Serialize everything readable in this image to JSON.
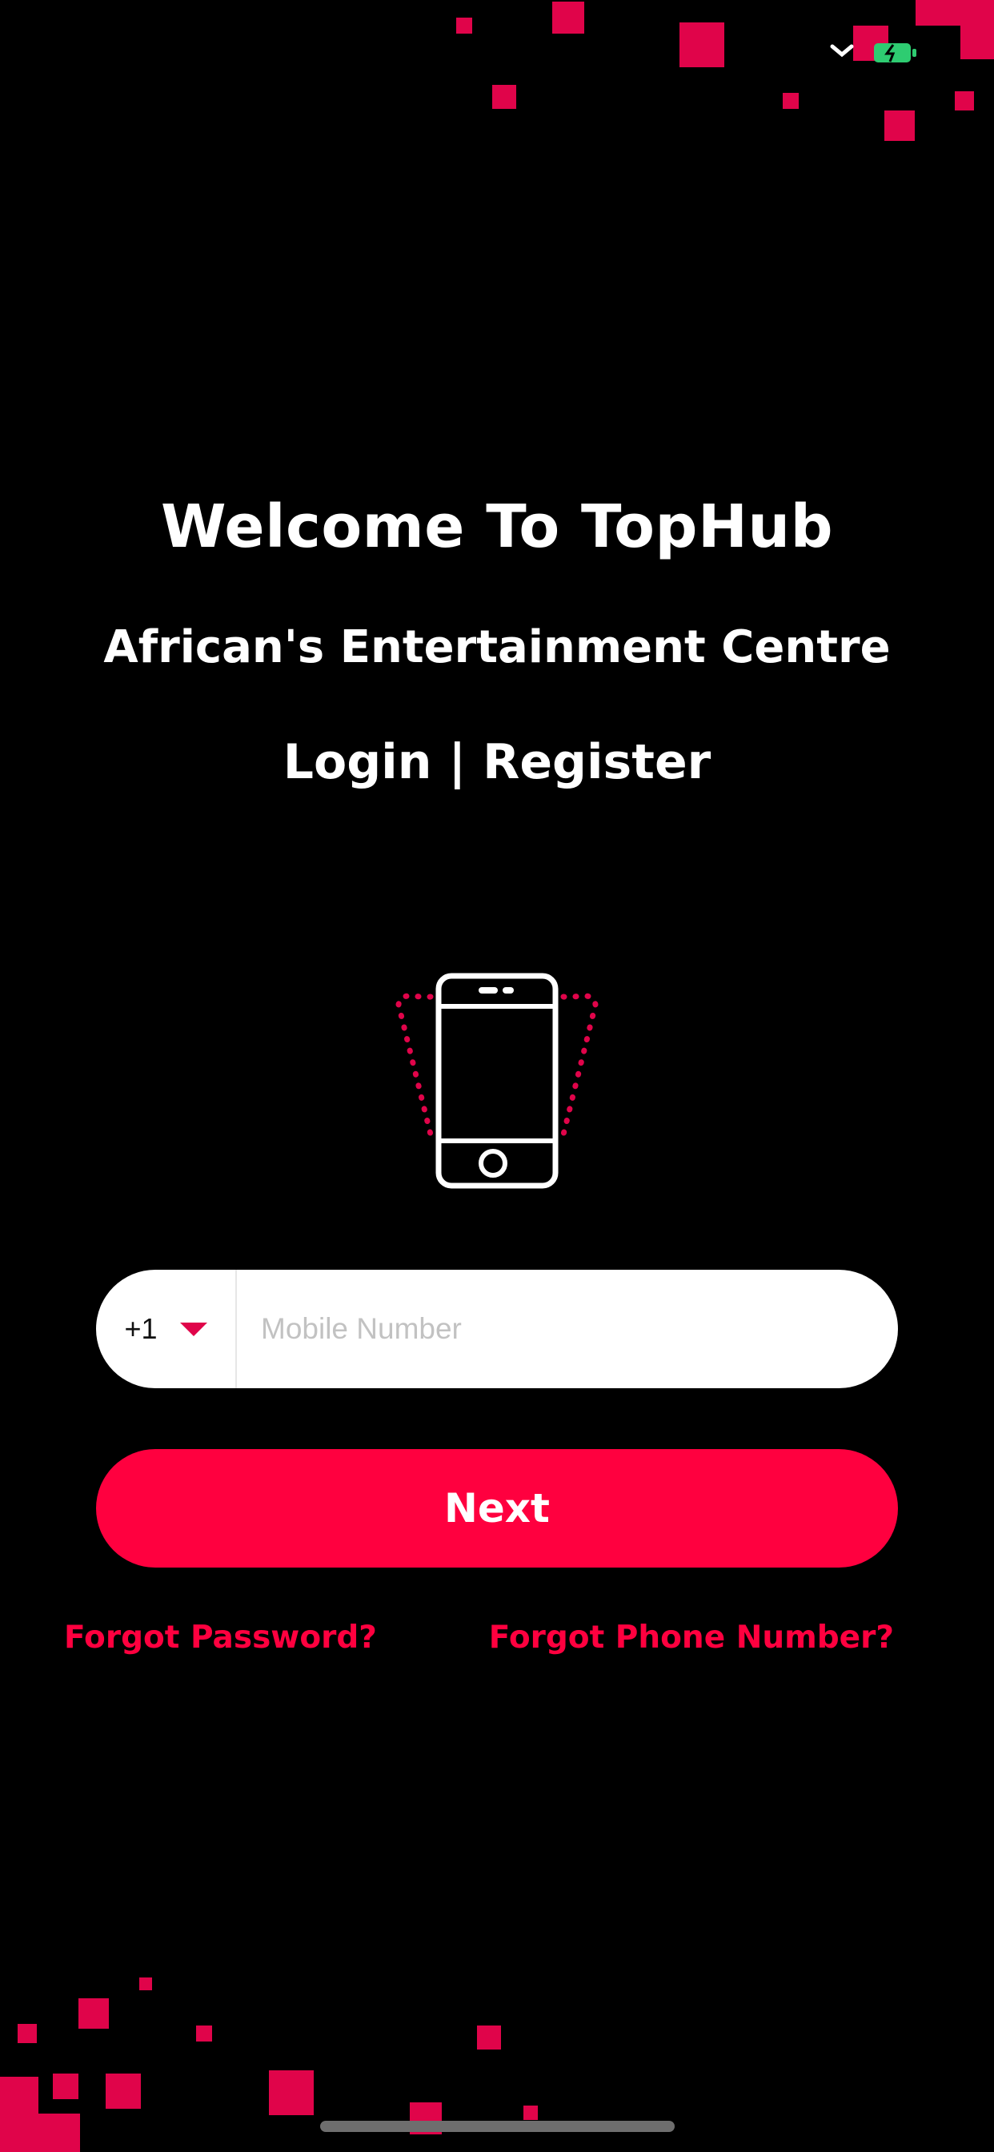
{
  "colors": {
    "background": "#000000",
    "accent": "#ff003f",
    "decor_square": "#e0044a",
    "battery": "#2ecc71"
  },
  "status_bar": {
    "icons": [
      "wifi-icon",
      "battery-icon"
    ]
  },
  "header": {
    "welcome": "Welcome To TopHub",
    "tagline": "African's Entertainment Centre",
    "login_register": "Login | Register"
  },
  "illustration": {
    "icon": "vibrating-phone-icon"
  },
  "phone_form": {
    "country_code": "+1",
    "country_dropdown_icon": "caret-down-icon",
    "mobile_placeholder": "Mobile Number",
    "mobile_value": ""
  },
  "actions": {
    "next_label": "Next",
    "forgot_password": "Forgot Password?",
    "forgot_phone": "Forgot Phone Number?"
  }
}
